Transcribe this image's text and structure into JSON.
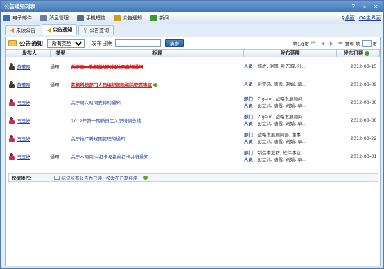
{
  "window": {
    "title": "公告通知列表"
  },
  "menu": {
    "items": [
      {
        "label": "电子邮件",
        "icon": "mail-icon",
        "color": "#3a6fb5"
      },
      {
        "label": "消息管理",
        "icon": "message-icon",
        "color": "#6a7f9a"
      },
      {
        "label": "手机短信",
        "icon": "phone-icon",
        "color": "#5a6b80"
      },
      {
        "label": "公告通知",
        "icon": "speaker-icon",
        "color": "#c8a020"
      },
      {
        "label": "新闻",
        "icon": "star-icon",
        "color": "#3a9a3a"
      }
    ],
    "right": [
      {
        "label": "桌面",
        "icon": "desktop-icon"
      },
      {
        "label": "OA主界面",
        "icon": "oa-icon"
      }
    ]
  },
  "tabs": [
    {
      "label": "未读公告",
      "icon": "speaker-icon",
      "active": false
    },
    {
      "label": "公告通知",
      "icon": "speaker-icon",
      "active": true
    },
    {
      "label": "公告查询",
      "icon": "search-icon",
      "active": false
    }
  ],
  "filter": {
    "title": "公告通知",
    "type_select": "所有类型",
    "date_label": "发布日期",
    "date_value": "",
    "confirm": "确定",
    "page_info": "第1/1页",
    "goto_label": "转到 第",
    "goto_value": "",
    "page_unit": "页"
  },
  "table": {
    "headers": [
      "发布人",
      "类型",
      "标题",
      "发布范围",
      "发布日期"
    ],
    "rows": [
      {
        "publisher": "黄若隈",
        "gender": "m",
        "type": "通知",
        "title": "关于五一放假值班的相关事宜的通知",
        "title_style": "redstrike",
        "scope": [
          {
            "k": "人员：",
            "v": "郭虎, 谢晖, 叶东辉, 叶…"
          }
        ],
        "date": "2012-08-15"
      },
      {
        "publisher": "黄若隈",
        "gender": "m",
        "type": "通知",
        "title": "紫枫科技部门人员编织图及相关职责事宜",
        "title_style": "red",
        "new": true,
        "scope": [
          {
            "k": "人员：",
            "v": "彭宜鸿, 唐霞, 刘娟, 草…"
          }
        ],
        "date": "2012-08-09"
      },
      {
        "publisher": "马玉婷",
        "gender": "f",
        "type": "",
        "title": "关于周六时间安排的通知",
        "title_style": "",
        "scope": [
          {
            "k": "部门：",
            "v": "Zigsun, 战略发展顾问…"
          },
          {
            "k": "人员：",
            "v": "彭宜鸿, 唐霞, 刘娟, 草…"
          }
        ],
        "date": "2012-08-30"
      },
      {
        "publisher": "马玉婷",
        "gender": "f",
        "type": "",
        "title": "2012年第一期新员工入职培训总结",
        "title_style": "",
        "scope": [
          {
            "k": "部门：",
            "v": "Zigsun, 战略发展顾问…"
          },
          {
            "k": "人员：",
            "v": "彭宜鸿, 唐霞, 刘娟, 草…"
          }
        ],
        "date": "2012-08-30"
      },
      {
        "publisher": "马玉婷",
        "gender": "f",
        "type": "",
        "title": "关于推广新规图管理的通知",
        "title_style": "",
        "scope": [
          {
            "k": "部门：",
            "v": "战略发展顾问部, 董事…"
          },
          {
            "k": "人员：",
            "v": "彭宜鸿, 唐霞, 刘娟, 草…"
          }
        ],
        "date": "2012-08-22"
      },
      {
        "publisher": "马玉婷",
        "gender": "f",
        "type": "通知",
        "title": "关于本周内oa打卡与指纹打卡并行通知",
        "title_style": "",
        "scope": [
          {
            "k": "部门：",
            "v": "制造事业群, 软件事业…"
          },
          {
            "k": "人员：",
            "v": "彭宜鸿, 唐霞, 刘娟, 草…"
          }
        ],
        "date": "2012-08-01"
      }
    ]
  },
  "footer": {
    "label": "快捷操作：",
    "mark_all": "标记所有公告为已读",
    "sort": "按发布日期排序"
  }
}
